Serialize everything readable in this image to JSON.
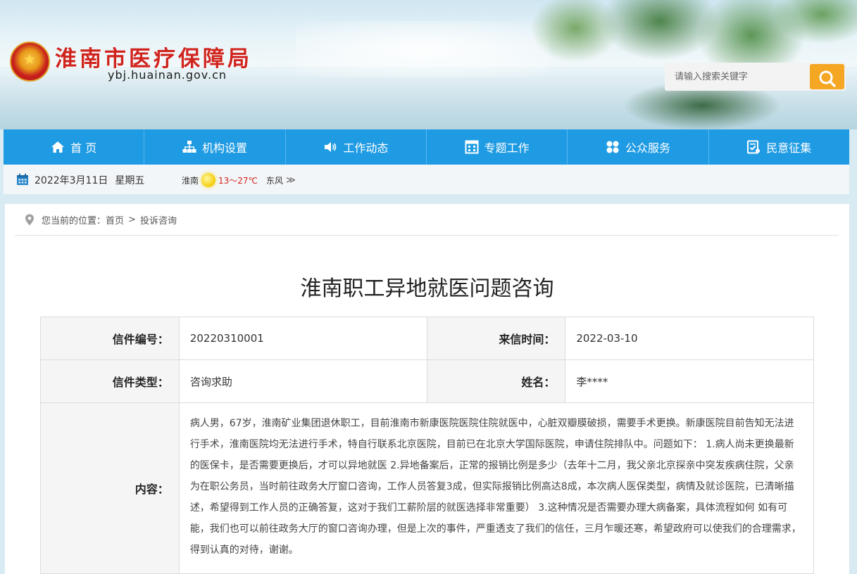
{
  "header": {
    "site_title": "淮南市医疗保障局",
    "site_domain": "ybj.huainan.gov.cn",
    "search_placeholder": "请输入搜索关键字"
  },
  "nav": {
    "items": [
      {
        "label": "首 页",
        "icon": "home-icon"
      },
      {
        "label": "机构设置",
        "icon": "org-chart-icon"
      },
      {
        "label": "工作动态",
        "icon": "speaker-icon"
      },
      {
        "label": "专题工作",
        "icon": "building-icon"
      },
      {
        "label": "公众服务",
        "icon": "grid-icon"
      },
      {
        "label": "民意征集",
        "icon": "survey-icon"
      }
    ]
  },
  "infobar": {
    "date": "2022年3月11日",
    "weekday": "星期五",
    "city": "淮南",
    "temp": "13～27℃",
    "wind": "东风",
    "more": "≫"
  },
  "breadcrumb": {
    "prefix": "您当前的位置：",
    "home": "首页",
    "separator": ">",
    "current": "投诉咨询"
  },
  "letter": {
    "title": "淮南职工异地就医问题咨询",
    "labels": {
      "number": "信件编号：",
      "time": "来信时间：",
      "type": "信件类型：",
      "name": "姓名：",
      "content": "内容："
    },
    "number": "20220310001",
    "time": "2022-03-10",
    "type": "咨询求助",
    "name": "李****",
    "content": "病人男，67岁，淮南矿业集团退休职工，目前淮南市新康医院医院住院就医中，心脏双瓣膜破损，需要手术更换。新康医院目前告知无法进行手术，淮南医院均无法进行手术，特自行联系北京医院，目前已在北京大学国际医院，申请住院排队中。问题如下： 1.病人尚未更换最新的医保卡，是否需要更换后，才可以异地就医 2.异地备案后，正常的报销比例是多少（去年十二月，我父亲北京探亲中突发疾病住院，父亲为在职公务员，当时前往政务大厅窗口咨询，工作人员答复3成，但实际报销比例高达8成，本次病人医保类型，病情及就诊医院，已清晰描述，希望得到工作人员的正确答复，这对于我们工薪阶层的就医选择非常重要） 3.这种情况是否需要办理大病备案，具体流程如何 如有可能，我们也可以前往政务大厅的窗口咨询办理，但是上次的事件，严重透支了我们的信任，三月乍暖还寒，希望政府可以使我们的合理需求，得到认真的对待，谢谢。"
  },
  "colors": {
    "nav_bg": "#1f9be3",
    "title_red": "#d0241e",
    "search_button": "#f5a623"
  }
}
